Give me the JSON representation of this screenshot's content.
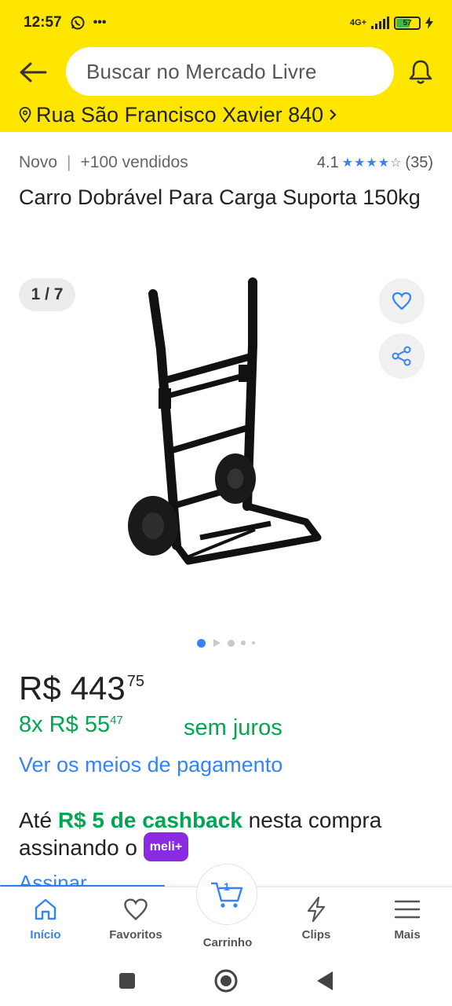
{
  "status_bar": {
    "time": "12:57",
    "notifications": "whatsapp-icon, more-dots",
    "network": "4G+",
    "battery_level": "57"
  },
  "header": {
    "search_placeholder": "Buscar no Mercado Livre",
    "address": "Rua São Francisco Xavier 840"
  },
  "product": {
    "condition": "Novo",
    "sold": "+100 vendidos",
    "rating_value": "4.1",
    "stars": "★★★★☆",
    "rating_count": "(35)",
    "title": "Carro Dobrável Para Carga Suporta 150kg",
    "image_counter": "1 / 7",
    "image_count": 7,
    "image_index": 1
  },
  "price": {
    "currency": "R$",
    "whole": "443",
    "cents": "75",
    "installments_prefix": "8x R$ 55",
    "installments_cents": "47",
    "installments_suffix": "sem juros",
    "payment_link": "Ver os meios de pagamento"
  },
  "cashback": {
    "prefix": "Até ",
    "highlight": "R$ 5 de cashback",
    "suffix": " nesta compra assinando o ",
    "badge": "meli+",
    "link": "Assinar"
  },
  "bottom_nav": {
    "items": [
      {
        "label": "Início",
        "icon": "home-icon",
        "active": true
      },
      {
        "label": "Favoritos",
        "icon": "heart-icon",
        "active": false
      },
      {
        "label": "Carrinho",
        "icon": "cart-icon",
        "active": false,
        "count": "1"
      },
      {
        "label": "Clips",
        "icon": "bolt-icon",
        "active": false
      },
      {
        "label": "Mais",
        "icon": "menu-icon",
        "active": false
      }
    ]
  },
  "colors": {
    "brand_yellow": "#ffe600",
    "link_blue": "#3483fa",
    "success_green": "#00a650",
    "meli_purple": "#8a2be2"
  }
}
